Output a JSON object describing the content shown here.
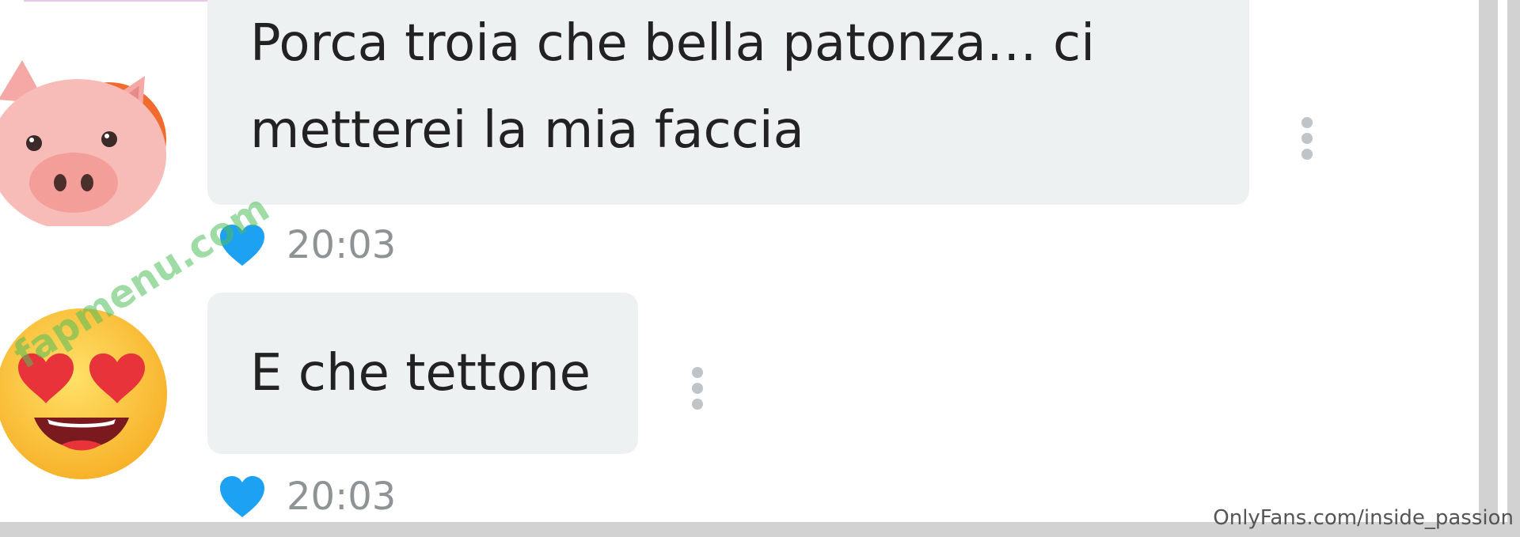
{
  "chat": {
    "messages": [
      {
        "text": "Porca troia che bella patonza… ci metterei la mia faccia",
        "time": "20:03",
        "avatar_icon": "pig-face-icon",
        "liked": true
      },
      {
        "text": "E che tettone",
        "time": "20:03",
        "avatar_icon": "heart-eyes-emoji-icon",
        "liked": true
      }
    ]
  },
  "overlay": {
    "watermark": "fapmenu.com",
    "source_credit": "OnlyFans.com/inside_passion"
  },
  "colors": {
    "bubble_bg": "#eef1f2",
    "heart_like": "#1da1f2",
    "timestamp": "#8e9396",
    "frame_gray": "#d2d2d2"
  }
}
